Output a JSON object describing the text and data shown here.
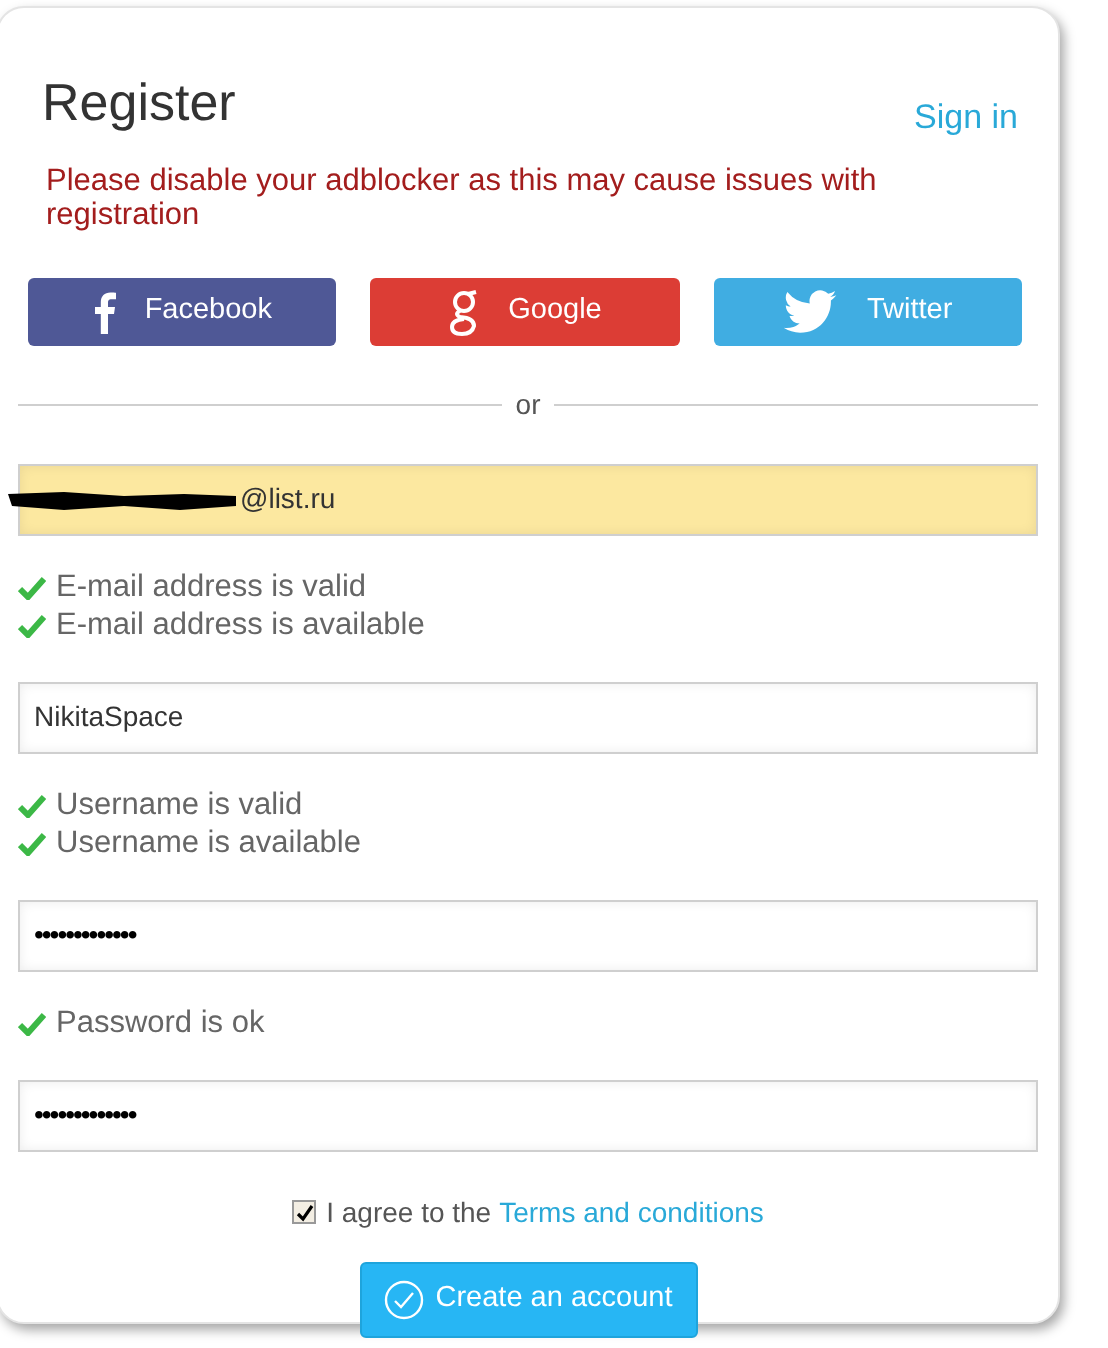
{
  "title": "Register",
  "sign_in_link": "Sign in",
  "warning": "Please disable your adblocker as this may cause issues with registration",
  "social_buttons": [
    {
      "kind": "facebook",
      "label": "Facebook"
    },
    {
      "kind": "google",
      "label": "Google"
    },
    {
      "kind": "twitter",
      "label": "Twitter"
    }
  ],
  "divider": "or",
  "fields": [
    {
      "kind": "email",
      "value": "@list.ru",
      "autofilled": true,
      "redacted": true,
      "messages": [
        {
          "passed": true,
          "text": "E-mail address is valid"
        },
        {
          "passed": true,
          "text": "E-mail address is available"
        }
      ]
    },
    {
      "kind": "text",
      "value": "NikitaSpace",
      "autofilled": false,
      "messages": [
        {
          "passed": true,
          "text": "Username is valid"
        },
        {
          "passed": true,
          "text": "Username is available"
        }
      ]
    },
    {
      "kind": "password",
      "value": "•••••••••••••",
      "autofilled": false,
      "messages": [
        {
          "passed": true,
          "text": "Password is ok"
        }
      ]
    },
    {
      "kind": "password",
      "value": "•••••••••••••",
      "autofilled": false
    }
  ],
  "agree": {
    "checked": true,
    "text": "I agree to the",
    "link": "Terms and conditions"
  },
  "submit_button": "Create an account"
}
